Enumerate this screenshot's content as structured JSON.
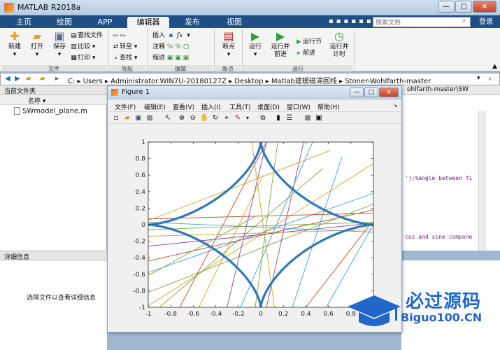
{
  "app": {
    "title": "MATLAB R2018a",
    "minimize": "—",
    "maximize": "□",
    "close": "×"
  },
  "ribbon_tabs": [
    "主页",
    "绘图",
    "APP",
    "编辑器",
    "发布",
    "视图"
  ],
  "search": {
    "placeholder": "搜索文档"
  },
  "login_label": "登录",
  "toolstrip": {
    "new": "新建",
    "open": "打开",
    "save": "保存",
    "find_files": "查找文件",
    "compare": "比较",
    "print": "打印",
    "goto": "转至",
    "find": "查找",
    "insert": "插入",
    "comment": "注释",
    "indent": "缩进",
    "breakpoints": "断点",
    "run": "运行",
    "run_advance_1": "运行并",
    "run_advance_2": "前进",
    "run_section": "运行节",
    "advance": "前进",
    "run_time_1": "运行并",
    "run_time_2": "计时",
    "sections": {
      "file": "文件",
      "navigate": "导航",
      "edit": "编辑",
      "breakpoints": "断点",
      "run": "运行"
    }
  },
  "address": {
    "path": "C: ▸ Users ▸ Administrator.WIN7U-20180127Z ▸ Desktop ▸ Matlab建模磁滞回线 ▸ Stoner-Wohlfarth-master"
  },
  "current_folder": {
    "title": "当前文件夹",
    "column_name": "名称 ▾",
    "files": [
      "SWmodel_plane.m"
    ]
  },
  "details": {
    "title": "详细信息",
    "hint": "选择文件以查看详细信息"
  },
  "editor": {
    "tab": "ohlfarth-master\\SW",
    "line1": "');%angle between fi",
    "line2": "cos and sine compone"
  },
  "figure": {
    "title": "Figure 1",
    "minimize": "—",
    "restore": "□",
    "close": "×",
    "menu": [
      "文件(F)",
      "编辑(E)",
      "查看(V)",
      "插入(I)",
      "工具(T)",
      "桌面(D)",
      "窗口(W)",
      "帮助(H)"
    ]
  },
  "watermark": {
    "cn": "必过源码",
    "en": "Biguo100.CN"
  },
  "colors": {
    "astroid": "#2f78b6",
    "ribbon": "#1f4f84",
    "watermark": "#2166c9"
  },
  "chart_data": {
    "type": "line",
    "xlim": [
      -1,
      1
    ],
    "ylim": [
      -1,
      1
    ],
    "xticks": [
      -1,
      -0.8,
      -0.6,
      -0.4,
      -0.2,
      0,
      0.2,
      0.4,
      0.6,
      0.8,
      1
    ],
    "yticks": [
      1,
      0.8,
      0.6,
      0.4,
      0.2,
      0,
      -0.2,
      -0.4,
      -0.6,
      -0.8,
      -1
    ],
    "grid": false,
    "astroid": {
      "curve": "x = cos^3(t), y = sin^3(t)",
      "color": "#2f78b6"
    },
    "tangent_lines": [
      {
        "x1": -1,
        "y1": -0.98,
        "x2": 1,
        "y2": 0.74,
        "color": "#d9a32a"
      },
      {
        "x1": -1,
        "y1": -0.82,
        "x2": 1,
        "y2": 0.25,
        "color": "#7aa83e"
      },
      {
        "x1": -1,
        "y1": -0.58,
        "x2": 1,
        "y2": 0.38,
        "color": "#3aa0d8"
      },
      {
        "x1": -1,
        "y1": -0.44,
        "x2": 1,
        "y2": 0.18,
        "color": "#c14b2a"
      },
      {
        "x1": -1,
        "y1": -0.26,
        "x2": 1,
        "y2": 0.02,
        "color": "#8c3fa6"
      },
      {
        "x1": -1,
        "y1": -0.14,
        "x2": 1,
        "y2": -0.06,
        "color": "#d9a32a"
      },
      {
        "x1": -1,
        "y1": 0.07,
        "x2": 1,
        "y2": 0.14,
        "color": "#c14b2a"
      },
      {
        "x1": -1,
        "y1": 0.03,
        "x2": 1,
        "y2": -0.09,
        "color": "#3aa0d8"
      },
      {
        "x1": -1,
        "y1": -0.06,
        "x2": 1,
        "y2": 0.03,
        "color": "#7aa83e"
      },
      {
        "x1": -1,
        "y1": 0.05,
        "x2": 0.62,
        "y2": 0.9,
        "color": "#d9a32a"
      },
      {
        "x1": -0.72,
        "y1": -1,
        "x2": 0.05,
        "y2": 1,
        "color": "#c14b2a"
      },
      {
        "x1": -0.3,
        "y1": -1,
        "x2": 0.05,
        "y2": 1,
        "color": "#8c3fa6"
      },
      {
        "x1": -0.18,
        "y1": -1,
        "x2": 0.46,
        "y2": 1,
        "color": "#3aa0d8"
      },
      {
        "x1": -0.05,
        "y1": -1,
        "x2": 0.15,
        "y2": 1,
        "color": "#7aa83e"
      },
      {
        "x1": 0.05,
        "y1": -1,
        "x2": 0.38,
        "y2": 1,
        "color": "#8c3fa6"
      },
      {
        "x1": 0.12,
        "y1": -1,
        "x2": -0.08,
        "y2": 1,
        "color": "#d9a32a"
      },
      {
        "x1": 0.28,
        "y1": -1,
        "x2": 0.72,
        "y2": 0.82,
        "color": "#3aa0d8"
      },
      {
        "x1": -0.98,
        "y1": -0.6,
        "x2": -0.05,
        "y2": 0.1,
        "color": "#7aa83e"
      },
      {
        "x1": 0.4,
        "y1": -1,
        "x2": 0.98,
        "y2": 0.02,
        "color": "#c14b2a"
      },
      {
        "x1": 0.58,
        "y1": -1,
        "x2": 1,
        "y2": 0.0,
        "color": "#3aa0d8"
      },
      {
        "x1": -0.55,
        "y1": -1,
        "x2": 0.02,
        "y2": 0.6,
        "color": "#d9a32a"
      },
      {
        "x1": -0.9,
        "y1": -1,
        "x2": 0.55,
        "y2": 0.68,
        "color": "#7aa83e"
      }
    ]
  }
}
